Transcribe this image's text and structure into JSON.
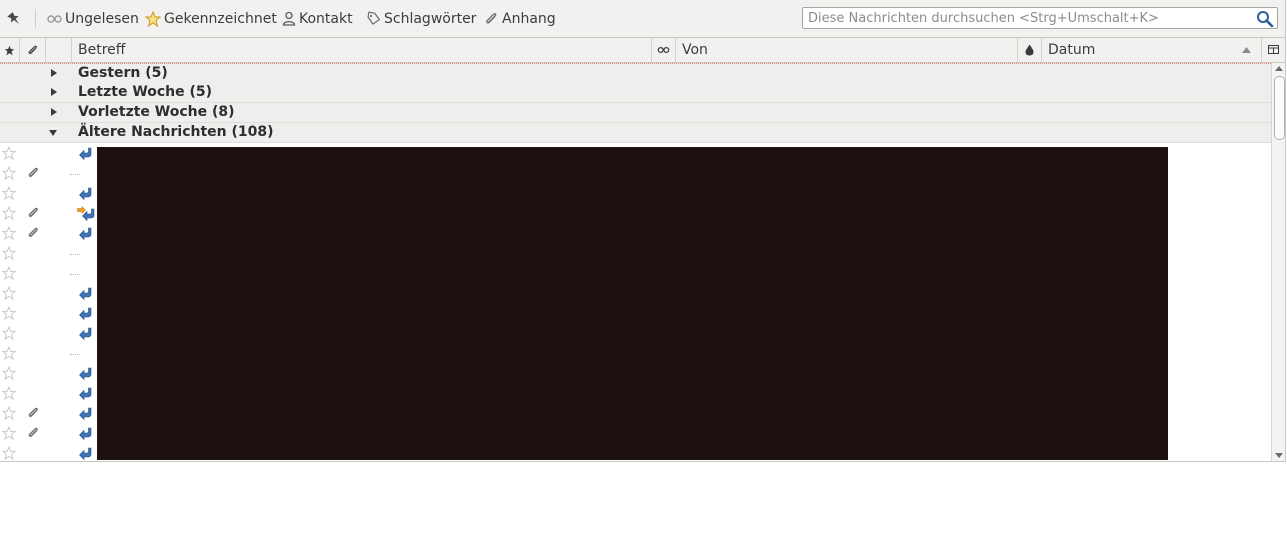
{
  "toolbar": {
    "unread_label": "Ungelesen",
    "starred_label": "Gekennzeichnet",
    "contact_label": "Kontakt",
    "tags_label": "Schlagwörter",
    "attachment_label": "Anhang"
  },
  "search": {
    "placeholder": "Diese Nachrichten durchsuchen <Strg+Umschalt+K>"
  },
  "columns": {
    "subject": "Betreff",
    "from": "Von",
    "date": "Datum"
  },
  "groups": [
    {
      "label": "Gestern (5)",
      "expanded": false
    },
    {
      "label": "Letzte Woche (5)",
      "expanded": false
    },
    {
      "label": "Vorletzte Woche (8)",
      "expanded": false
    },
    {
      "label": "Ältere Nachrichten (108)",
      "expanded": true
    }
  ],
  "messages": [
    {
      "attachment": false,
      "replied": true,
      "forwarded": false
    },
    {
      "attachment": true,
      "replied": false,
      "forwarded": false
    },
    {
      "attachment": false,
      "replied": true,
      "forwarded": false
    },
    {
      "attachment": true,
      "replied": true,
      "forwarded": true
    },
    {
      "attachment": true,
      "replied": true,
      "forwarded": false
    },
    {
      "attachment": false,
      "replied": false,
      "forwarded": false
    },
    {
      "attachment": false,
      "replied": false,
      "forwarded": false
    },
    {
      "attachment": false,
      "replied": true,
      "forwarded": false
    },
    {
      "attachment": false,
      "replied": true,
      "forwarded": false
    },
    {
      "attachment": false,
      "replied": true,
      "forwarded": false
    },
    {
      "attachment": false,
      "replied": false,
      "forwarded": false
    },
    {
      "attachment": false,
      "replied": true,
      "forwarded": false
    },
    {
      "attachment": false,
      "replied": true,
      "forwarded": false
    },
    {
      "attachment": true,
      "replied": true,
      "forwarded": false
    },
    {
      "attachment": true,
      "replied": true,
      "forwarded": false
    },
    {
      "attachment": false,
      "replied": true,
      "forwarded": false
    }
  ],
  "colors": {
    "toolbar_bg": "#f2f1f0",
    "group_bg": "#efeeed",
    "redaction": "#1c1011",
    "reply_icon": "#3f74b5",
    "star_icon": "#e7b616"
  }
}
